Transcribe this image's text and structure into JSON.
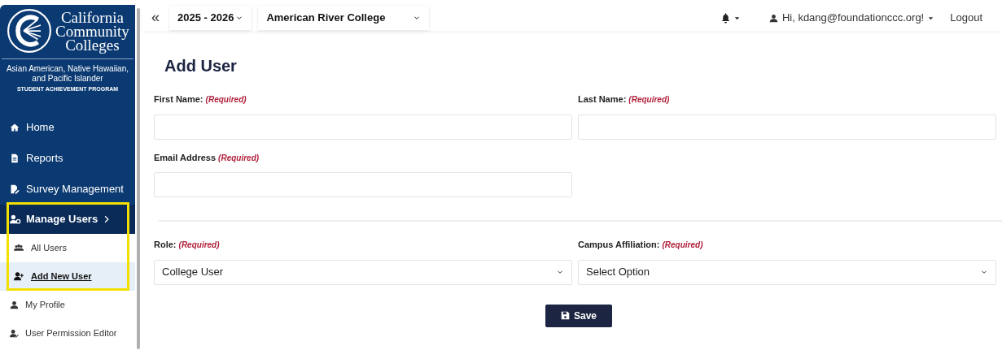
{
  "sidebar": {
    "logo_lines": [
      "California",
      "Community",
      "Colleges"
    ],
    "program": "Asian American, Native Hawaiian, and Pacific Islander",
    "program_subtitle": "STUDENT ACHIEVEMENT PROGRAM",
    "items": [
      {
        "label": "Home"
      },
      {
        "label": "Reports"
      },
      {
        "label": "Survey Management"
      },
      {
        "label": "Manage Users",
        "expanded": true,
        "children": [
          {
            "label": "All Users",
            "selected": false
          },
          {
            "label": "Add New User",
            "selected": true
          }
        ]
      },
      {
        "label": "My Profile"
      },
      {
        "label": "User Permission Editor"
      }
    ]
  },
  "topbar": {
    "collapse": "«",
    "year": "2025 - 2026",
    "college": "American River College",
    "greeting": "Hi, kdang@foundationccc.org!",
    "logout": "Logout"
  },
  "form": {
    "title": "Add User",
    "rows": [
      [
        {
          "label": "First Name:",
          "required": "(Required)",
          "kind": "input"
        },
        {
          "label": "Last Name:",
          "required": "(Required)",
          "kind": "input"
        }
      ],
      [
        {
          "label": "Email Address",
          "required": "(Required)",
          "kind": "input"
        }
      ],
      [
        {
          "label": "Role:",
          "required": "(Required)",
          "kind": "select",
          "value": "College User"
        },
        {
          "label": "Campus Affiliation:",
          "required": "(Required)",
          "kind": "select",
          "value": "Select Option"
        }
      ]
    ],
    "save": "Save"
  }
}
